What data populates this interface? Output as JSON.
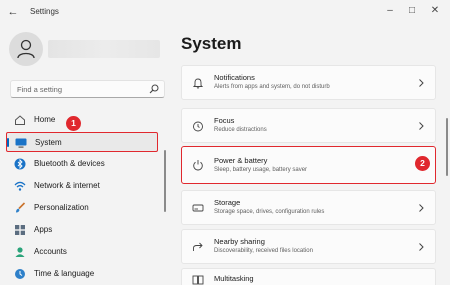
{
  "window": {
    "title": "Settings",
    "back_icon": "back-arrow-icon",
    "controls": [
      "minimize-icon",
      "maximize-icon",
      "close-icon"
    ]
  },
  "user": {
    "avatar_icon": "person-icon"
  },
  "search": {
    "placeholder": "Find a setting",
    "icon": "search-icon"
  },
  "sidebar": {
    "items": [
      {
        "label": "Home",
        "icon": "home-icon",
        "selected": false
      },
      {
        "label": "System",
        "icon": "monitor-icon",
        "selected": true
      },
      {
        "label": "Bluetooth & devices",
        "icon": "bluetooth-icon",
        "selected": false
      },
      {
        "label": "Network & internet",
        "icon": "wifi-icon",
        "selected": false
      },
      {
        "label": "Personalization",
        "icon": "brush-icon",
        "selected": false
      },
      {
        "label": "Apps",
        "icon": "apps-icon",
        "selected": false
      },
      {
        "label": "Accounts",
        "icon": "account-icon",
        "selected": false
      },
      {
        "label": "Time & language",
        "icon": "globe-clock-icon",
        "selected": false
      }
    ]
  },
  "main": {
    "title": "System",
    "cards": [
      {
        "title": "Notifications",
        "subtitle": "Alerts from apps and system, do not disturb",
        "icon": "bell-icon"
      },
      {
        "title": "Focus",
        "subtitle": "Reduce distractions",
        "icon": "focus-icon"
      },
      {
        "title": "Power & battery",
        "subtitle": "Sleep, battery usage, battery saver",
        "icon": "power-icon",
        "highlighted": true
      },
      {
        "title": "Storage",
        "subtitle": "Storage space, drives, configuration rules",
        "icon": "storage-icon"
      },
      {
        "title": "Nearby sharing",
        "subtitle": "Discoverability, received files location",
        "icon": "share-icon"
      },
      {
        "title": "Multitasking",
        "subtitle": "",
        "icon": "multitasking-icon"
      }
    ]
  },
  "annotations": {
    "step1": "1",
    "step2": "2"
  },
  "colors": {
    "accent": "#0067c0",
    "highlight": "#e0282e",
    "background": "#f3f3f3",
    "card": "#fbfbfb"
  }
}
